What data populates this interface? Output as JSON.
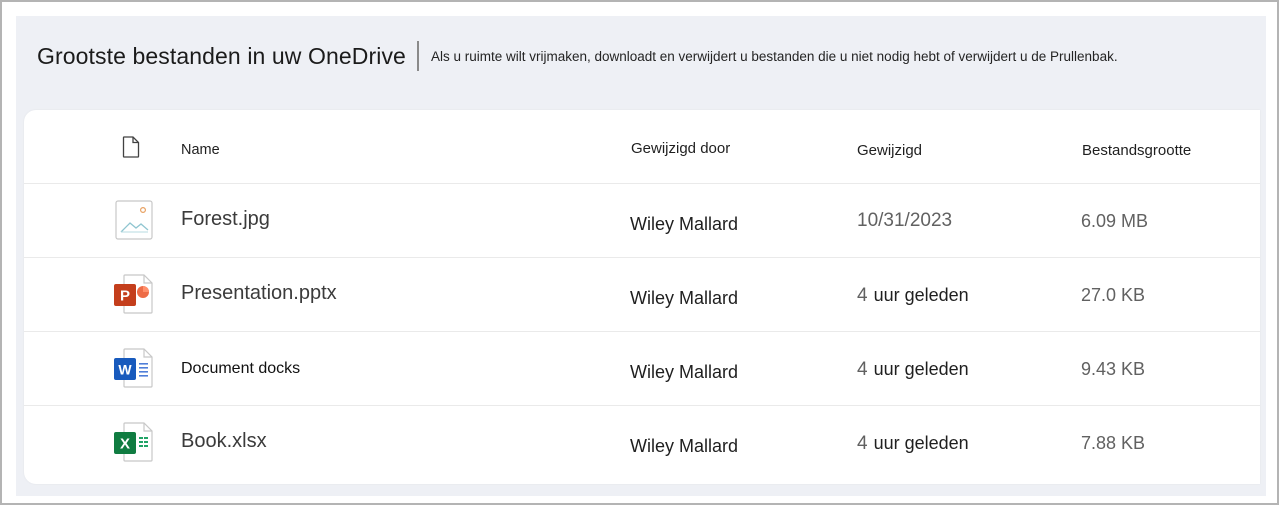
{
  "header": {
    "title": "Grootste bestanden in uw OneDrive",
    "subtitle": "Als u ruimte wilt vrijmaken, downloadt en verwijdert u bestanden die u niet nodig hebt of verwijdert u de Prullenbak."
  },
  "columns": {
    "icon": "file-icon",
    "name": "Name",
    "modified_by": "Gewijzigd door",
    "modified": "Gewijzigd",
    "size": "Bestandsgrootte"
  },
  "files": [
    {
      "icon": "image-file-icon",
      "name": "Forest.jpg",
      "modified_by": "Wiley Mallard",
      "modified_num": "10/31/2023",
      "modified_txt": "",
      "size": "6.09 MB"
    },
    {
      "icon": "powerpoint-file-icon",
      "name": "Presentation.pptx",
      "modified_by": "Wiley Mallard",
      "modified_num": "4",
      "modified_txt": "uur geleden",
      "size": "27.0 KB"
    },
    {
      "icon": "word-file-icon",
      "name": "Document docks",
      "modified_by": "Wiley Mallard",
      "modified_num": "4",
      "modified_txt": "uur geleden",
      "size": "9.43 KB"
    },
    {
      "icon": "excel-file-icon",
      "name": "Book.xlsx",
      "modified_by": "Wiley Mallard",
      "modified_num": "4",
      "modified_txt": "uur geleden",
      "size": "7.88 KB"
    }
  ],
  "colors": {
    "panel": "#eef0f5",
    "powerpoint": "#c43e1c",
    "word": "#185abd",
    "excel": "#107c41"
  }
}
